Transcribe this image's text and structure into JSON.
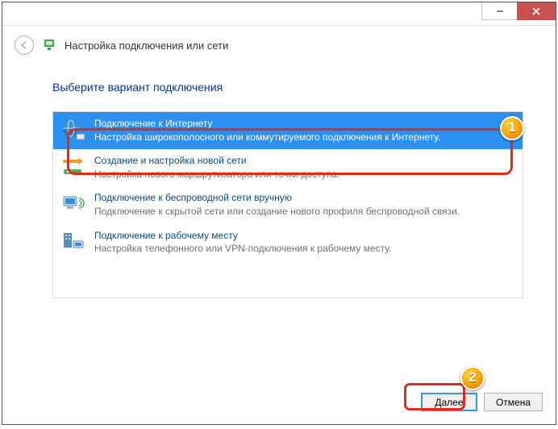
{
  "window": {
    "title": "Настройка подключения или сети"
  },
  "heading": "Выберите вариант подключения",
  "options": [
    {
      "title": "Подключение к Интернету",
      "desc": "Настройка широкополосного или коммутируемого подключения к Интернету."
    },
    {
      "title": "Создание и настройка новой сети",
      "desc": "Настройка нового маршрутизатора или точки доступа."
    },
    {
      "title": "Подключение к беспроводной сети вручную",
      "desc": "Подключение к скрытой сети или создание нового профиля беспроводной связи."
    },
    {
      "title": "Подключение к рабочему месту",
      "desc": "Настройка телефонного или VPN-подключения к рабочему месту."
    }
  ],
  "buttons": {
    "next": "Далее",
    "cancel": "Отмена"
  },
  "badges": {
    "b1": "1",
    "b2": "2"
  }
}
